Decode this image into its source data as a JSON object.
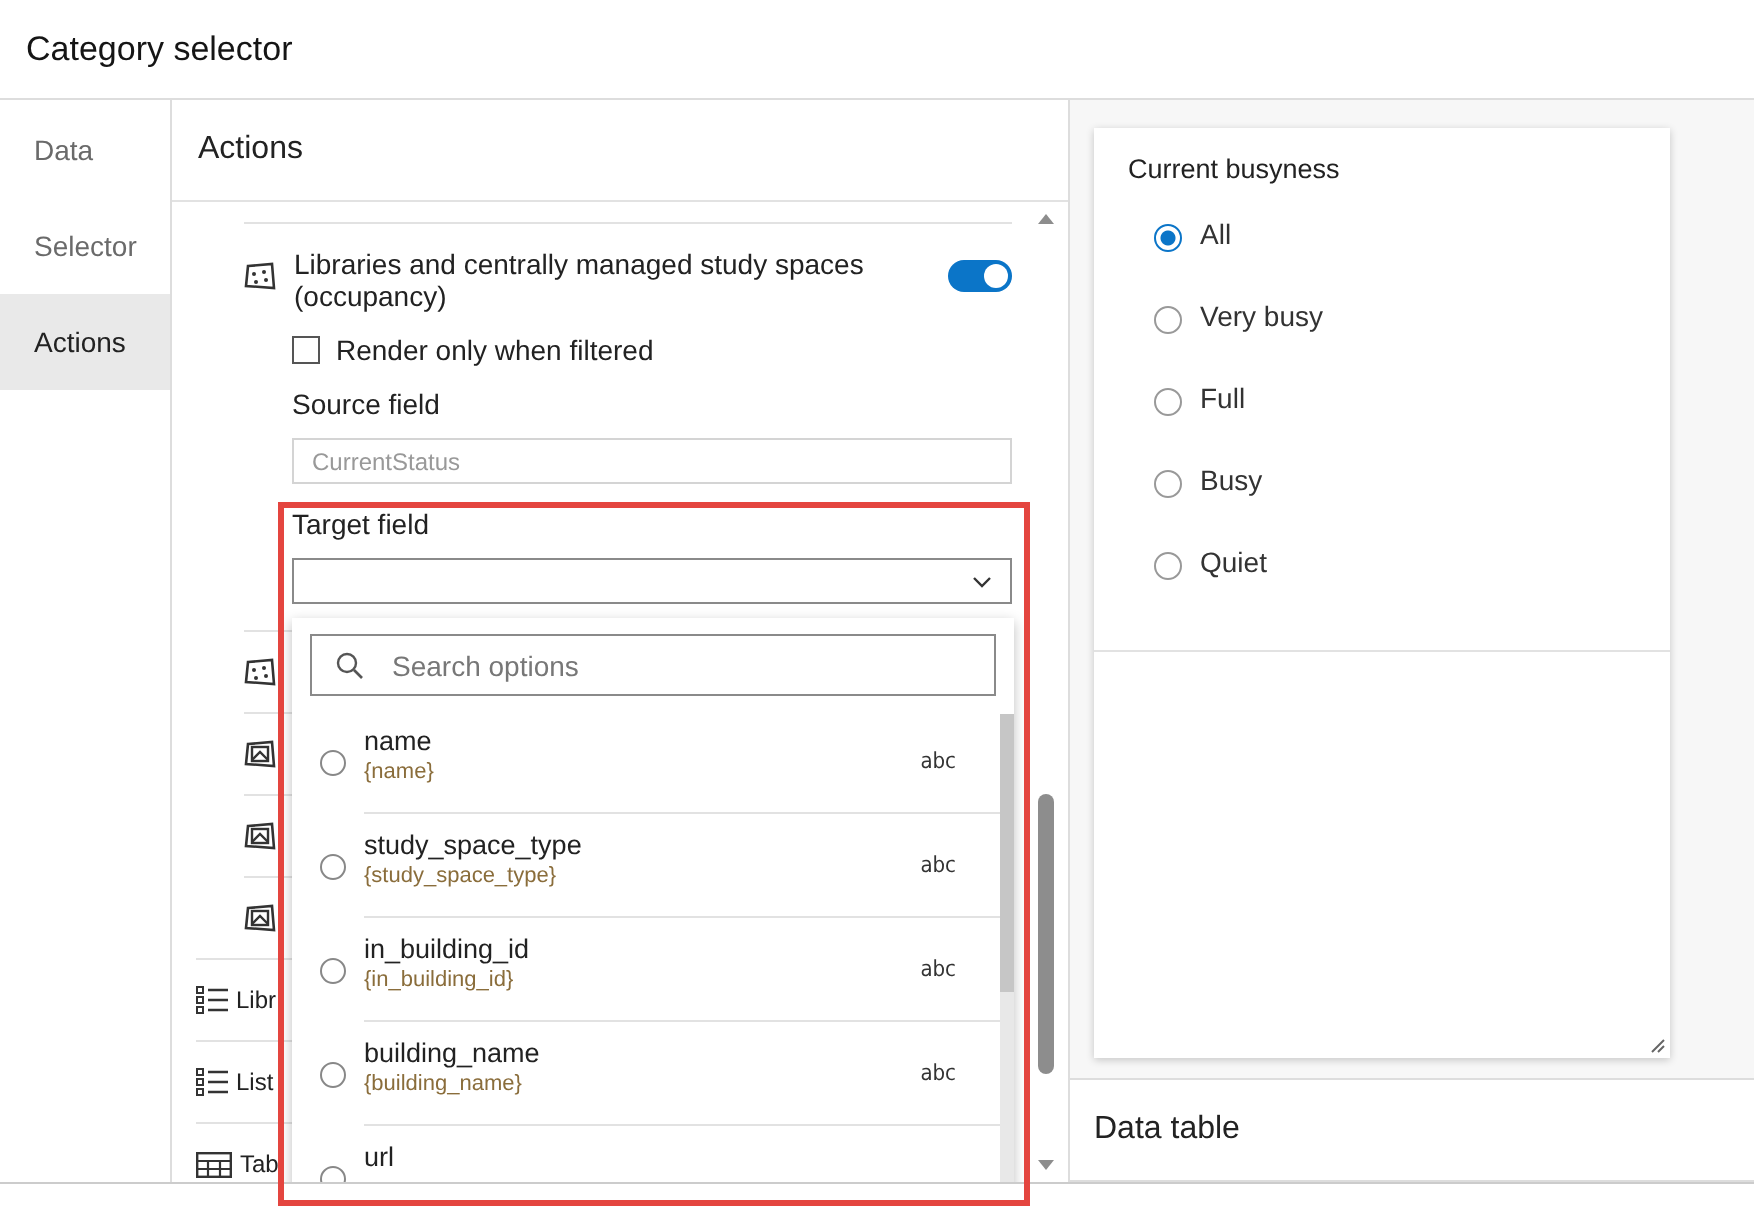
{
  "window": {
    "title": "Category selector"
  },
  "sidebar": {
    "tabs": [
      {
        "label": "Data",
        "selected": false
      },
      {
        "label": "Selector",
        "selected": false
      },
      {
        "label": "Actions",
        "selected": true
      }
    ]
  },
  "actions_panel": {
    "title": "Actions",
    "layer": {
      "name": "Libraries and centrally managed study spaces (occupancy)",
      "enabled": true,
      "render_only_when_filtered": {
        "label": "Render only when filtered",
        "checked": false
      },
      "source_field": {
        "label": "Source field",
        "value": "CurrentStatus",
        "disabled": true
      },
      "target_field": {
        "label": "Target field"
      }
    },
    "other_layers": [
      {
        "kind": "points"
      },
      {
        "kind": "image"
      },
      {
        "kind": "image"
      },
      {
        "kind": "image"
      }
    ],
    "widgets": [
      {
        "kind": "list",
        "label": "Libr"
      },
      {
        "kind": "list",
        "label": "List"
      },
      {
        "kind": "table",
        "label": "Tab"
      }
    ],
    "dropdown": {
      "placeholder": "Search options",
      "options": [
        {
          "name": "name",
          "expression": "{name}",
          "type": "abc",
          "selected": false
        },
        {
          "name": "study_space_type",
          "expression": "{study_space_type}",
          "type": "abc",
          "selected": false
        },
        {
          "name": "in_building_id",
          "expression": "{in_building_id}",
          "type": "abc",
          "selected": false
        },
        {
          "name": "building_name",
          "expression": "{building_name}",
          "type": "abc",
          "selected": false
        },
        {
          "name": "url",
          "selected": false
        }
      ]
    },
    "highlight": true
  },
  "preview": {
    "filter": {
      "title": "Current busyness",
      "options": [
        {
          "label": "All",
          "selected": true
        },
        {
          "label": "Very busy",
          "selected": false
        },
        {
          "label": "Full",
          "selected": false
        },
        {
          "label": "Busy",
          "selected": false
        },
        {
          "label": "Quiet",
          "selected": false
        }
      ]
    },
    "data_table": {
      "title": "Data table"
    }
  }
}
